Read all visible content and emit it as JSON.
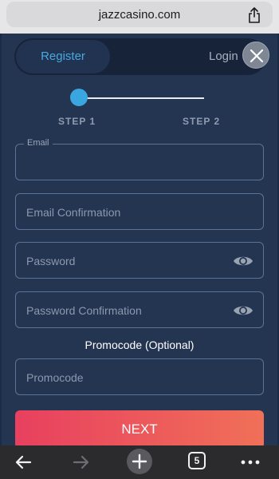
{
  "browser": {
    "url": "jazzcasino.com",
    "share_icon": "share-icon",
    "toolbar": {
      "back_icon": "arrow-left-icon",
      "forward_icon": "arrow-right-icon",
      "new_tab_icon": "plus-icon",
      "tabs_count": "5",
      "more_icon": "more-icon"
    }
  },
  "modal": {
    "tabs": {
      "register": "Register",
      "login": "Login"
    },
    "active_tab": "Register",
    "close_icon": "close-icon",
    "steps": {
      "step1": "STEP 1",
      "step2": "STEP 2",
      "current": 1
    },
    "fields": {
      "email": {
        "label": "Email",
        "value": ""
      },
      "email_confirmation": {
        "placeholder": "Email Confirmation"
      },
      "password": {
        "placeholder": "Password",
        "icon": "eye-icon"
      },
      "password_confirmation": {
        "placeholder": "Password Confirmation",
        "icon": "eye-icon"
      }
    },
    "promocode": {
      "title": "Promocode (Optional)",
      "placeholder": "Promocode"
    },
    "next_button": "NEXT",
    "colors": {
      "accent": "#3aa6e0",
      "button_gradient_start": "#e8405f",
      "button_gradient_end": "#f07058",
      "background": "#243552"
    }
  }
}
